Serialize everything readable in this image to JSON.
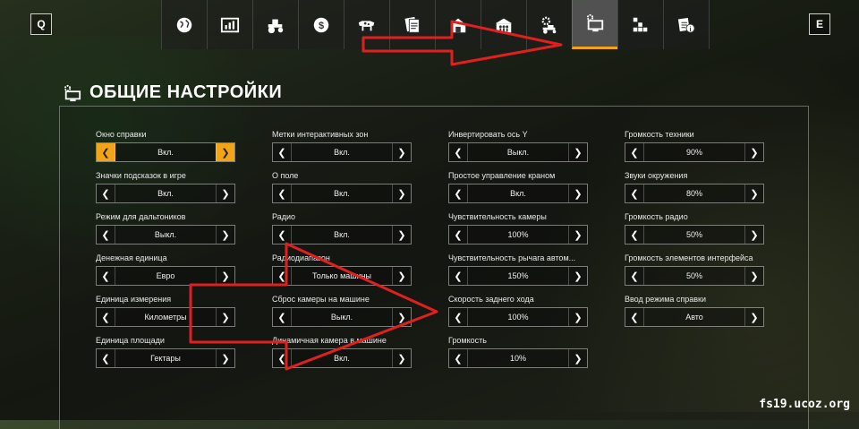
{
  "nav": {
    "left_key": "Q",
    "right_key": "E",
    "tabs": [
      {
        "icon": "globe-icon"
      },
      {
        "icon": "stats-icon"
      },
      {
        "icon": "tractor-icon"
      },
      {
        "icon": "money-icon"
      },
      {
        "icon": "animals-icon"
      },
      {
        "icon": "contracts-icon"
      },
      {
        "icon": "farm-icon"
      },
      {
        "icon": "farmers-icon"
      },
      {
        "icon": "game-settings-icon"
      },
      {
        "icon": "general-settings-icon",
        "active": true
      },
      {
        "icon": "controls-icon"
      },
      {
        "icon": "help-icon"
      }
    ],
    "accent": "#f2a316"
  },
  "page": {
    "title": "ОБЩИЕ НАСТРОЙКИ"
  },
  "settings": [
    [
      {
        "label": "Окно справки",
        "value": "Вкл.",
        "highlight": true
      },
      {
        "label": "Значки подсказок в игре",
        "value": "Вкл."
      },
      {
        "label": "Режим для дальтоников",
        "value": "Выкл."
      },
      {
        "label": "Денежная единица",
        "value": "Евро"
      },
      {
        "label": "Единица измерения",
        "value": "Километры"
      },
      {
        "label": "Единица площади",
        "value": "Гектары"
      }
    ],
    [
      {
        "label": "Метки интерактивных зон",
        "value": "Вкл."
      },
      {
        "label": "О поле",
        "value": "Вкл."
      },
      {
        "label": "Радио",
        "value": "Вкл."
      },
      {
        "label": "Радиодиапазон",
        "value": "Только машины"
      },
      {
        "label": "Сброс камеры на машине",
        "value": "Выкл."
      },
      {
        "label": "Динамичная камера в машине",
        "value": "Вкл."
      }
    ],
    [
      {
        "label": "Инвертировать ось Y",
        "value": "Выкл."
      },
      {
        "label": "Простое управление краном",
        "value": "Вкл."
      },
      {
        "label": "Чувствительность камеры",
        "value": "100%"
      },
      {
        "label": "Чувствительность рычага автом...",
        "value": "150%"
      },
      {
        "label": "Скорость заднего хода",
        "value": "100%"
      },
      {
        "label": "Громкость",
        "value": "10%"
      }
    ],
    [
      {
        "label": "Громкость техники",
        "value": "90%"
      },
      {
        "label": "Звуки окружения",
        "value": "80%"
      },
      {
        "label": "Громкость радио",
        "value": "50%"
      },
      {
        "label": "Громкость элементов интерфейса",
        "value": "50%"
      },
      {
        "label": "Ввод режима справки",
        "value": "Авто"
      }
    ]
  ],
  "watermark": "fs19.ucoz.org"
}
